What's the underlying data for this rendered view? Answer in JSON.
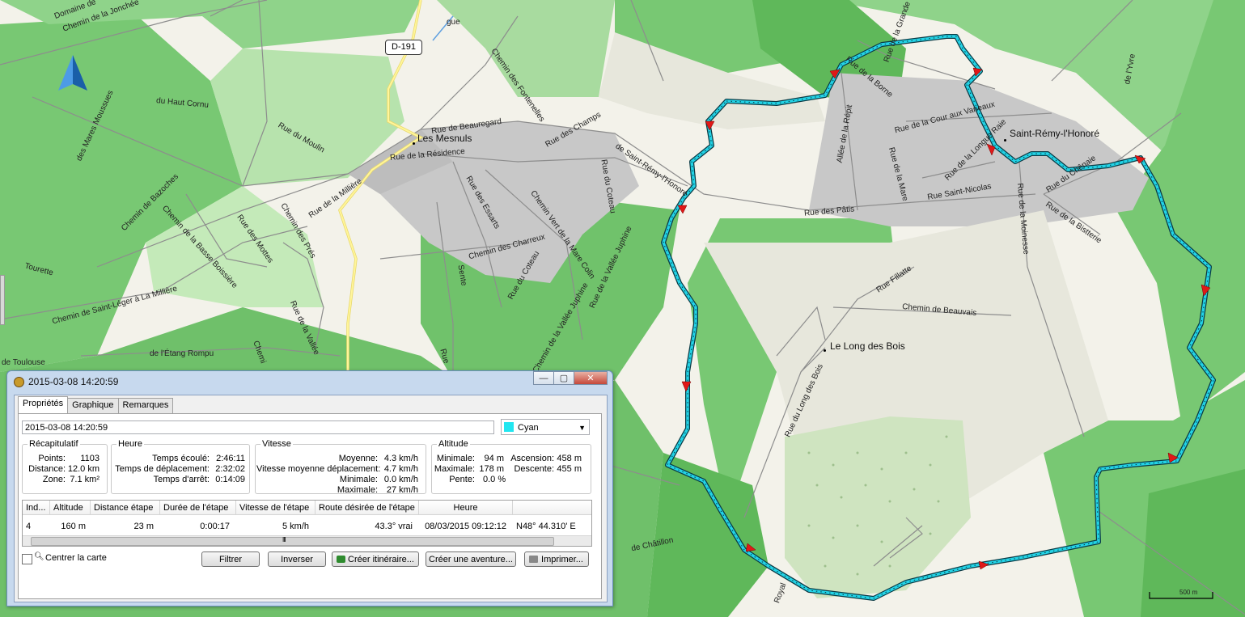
{
  "map": {
    "road_shield": "D-191",
    "places": [
      "Les Mesnuls",
      "Saint-Rémy-l'Honoré",
      "Le Long des Bois"
    ],
    "streets": [
      "Domaine de",
      "Chemin de la Jonchée",
      "Rue de Beauregard",
      "Rue de la Résidence",
      "Rue des Champs",
      "Chemin des Fontenelles",
      "Rue du Moulin",
      "du Haut Cornu",
      "des Mares Moussues",
      "Chemin de Bazoches",
      "Rue de la Millière",
      "Chemin de la Basse Boissière",
      "Chemin des Prés",
      "Rue des Mottes",
      "Rue des Essarts",
      "Chemin Vert de la Mare Colin",
      "Chemin des Charreux",
      "Rue du Coteau",
      "de Saint-Rémy-l'Honoré",
      "Rue du Coteau",
      "Rue de la Vallée Juphine",
      "Chemin de la Vallée Juphine",
      "Rue de la Vallée",
      "Chemin de Saint-Léger à La Millière",
      "de l'Étang Rompu",
      "Tourette",
      "de Toulouse",
      "Rue de la Borne",
      "Allée de la Répit",
      "Rue de la Cour aux Vaneaux",
      "Rue de la Longue Raie",
      "Rue de la Mare",
      "Rue des Pâtis",
      "Rue Saint-Nicolas",
      "Rue de la Moinesse",
      "Rue de la Bistterie",
      "Rue du Chênaie",
      "Rue Fillatte",
      "Chemin de Beauvais",
      "Rue du Long des Bois",
      "de Châtillon",
      "Royal",
      "Sente",
      "Rue",
      "gue",
      "Rue de la Grande Meule",
      "de l'Yvre",
      "Chemi"
    ],
    "scale_label": "500 m",
    "track_color": "#22d3e6"
  },
  "dialog": {
    "title": "2015-03-08 14:20:59",
    "window_buttons": {
      "min": "—",
      "max": "▢",
      "close": "✕"
    },
    "tabs": [
      "Propriétés",
      "Graphique",
      "Remarques"
    ],
    "name_value": "2015-03-08 14:20:59",
    "color": {
      "label": "Cyan",
      "hex": "#22e6f0"
    },
    "recap": {
      "legend": "Récapitulatif",
      "points_label": "Points:",
      "points": "1103",
      "distance_label": "Distance:",
      "distance": "12.0 km",
      "zone_label": "Zone:",
      "zone": "7.1 km²"
    },
    "heure": {
      "legend": "Heure",
      "ecoule_label": "Temps écoulé:",
      "ecoule": "2:46:11",
      "deplacement_label": "Temps de déplacement:",
      "deplacement": "2:32:02",
      "arret_label": "Temps d'arrêt:",
      "arret": "0:14:09"
    },
    "vitesse": {
      "legend": "Vitesse",
      "moyenne_label": "Moyenne:",
      "moyenne": "4.3 km/h",
      "moy_dep_label": "Vitesse moyenne déplacement:",
      "moy_dep": "4.7 km/h",
      "minimale_label": "Minimale:",
      "minimale": "0.0 km/h",
      "maximale_label": "Maximale:",
      "maximale": "27 km/h"
    },
    "altitude": {
      "legend": "Altitude",
      "minimale_label": "Minimale:",
      "minimale": "94 m",
      "maximale_label": "Maximale:",
      "maximale": "178 m",
      "pente_label": "Pente:",
      "pente": "0.0 %",
      "ascension_label": "Ascension:",
      "ascension": "458 m",
      "descente_label": "Descente:",
      "descente": "455 m"
    },
    "table": {
      "headers": [
        "Ind...",
        "Altitude",
        "Distance étape",
        "Durée de l'étape",
        "Vitesse de l'étape",
        "Route désirée de l'étape",
        "Heure",
        ""
      ],
      "row": [
        "4",
        "160 m",
        "23 m",
        "0:00:17",
        "5 km/h",
        "43.3° vrai",
        "08/03/2015 09:12:12",
        "N48° 44.310' E"
      ],
      "scroll_glyph": "III"
    },
    "center_map_label": "Centrer la carte",
    "buttons": {
      "filtrer": "Filtrer",
      "inverser": "Inverser",
      "creer_itineraire": "Créer itinéraire...",
      "creer_aventure": "Créer une aventure...",
      "imprimer": "Imprimer..."
    }
  }
}
